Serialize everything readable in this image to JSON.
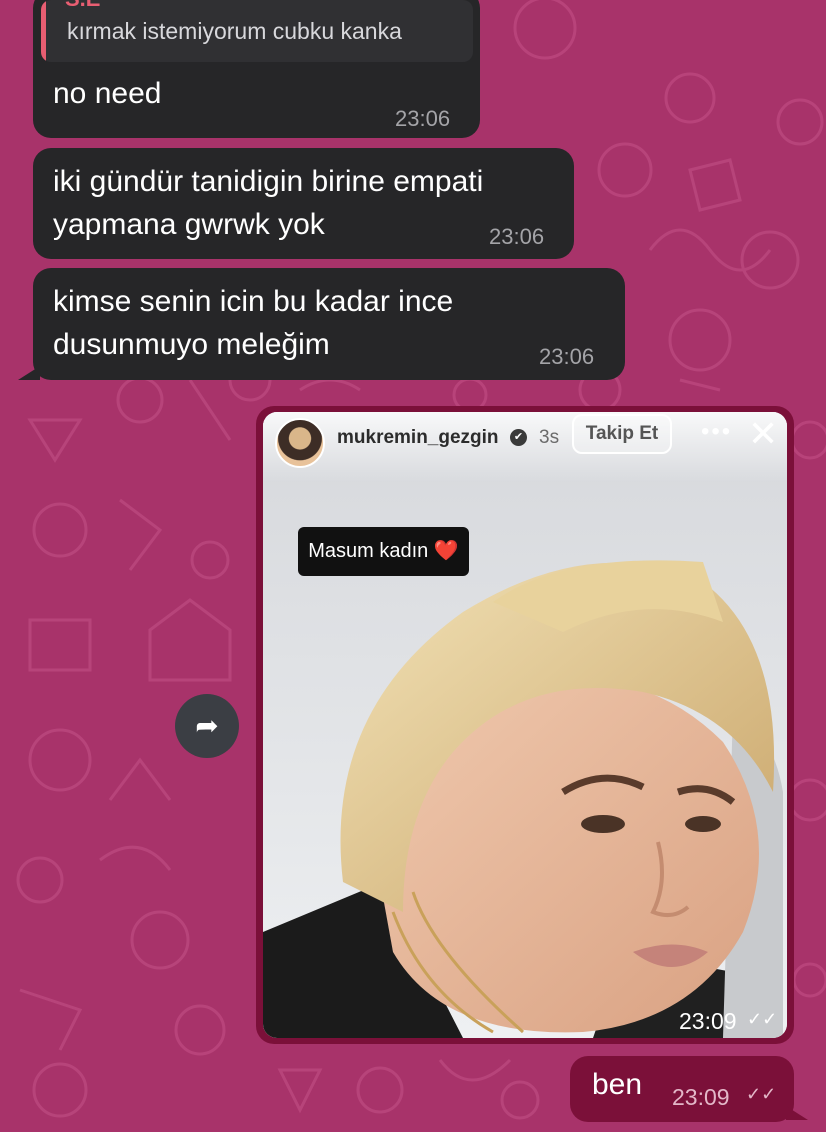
{
  "chat": {
    "reply_preview": {
      "name": "S.E",
      "text": "kırmak istemiyorum cubku kanka"
    },
    "messages": [
      {
        "text": "no need",
        "time": "23:06"
      },
      {
        "text": "iki gündür tanidigin birine empati yapmana gwrwk yok",
        "time": "23:06"
      },
      {
        "text": "kimse senin icin bu kadar ince dusunmuyo meleğim",
        "time": "23:06"
      }
    ],
    "story": {
      "username": "mukremin_gezgin",
      "verified_glyph": "✔",
      "age": "3s",
      "follow_label": "Takip Et",
      "more_glyph": "•••",
      "close_glyph": "✕",
      "sticker_text": "Masum kadın ❤️",
      "time": "23:09",
      "check_glyph": "✓✓"
    },
    "forward_glyph": "➦",
    "outgoing": {
      "text": "ben",
      "time": "23:09",
      "check_glyph": "✓✓"
    }
  },
  "colors": {
    "wallpaper": "#a8336a",
    "incoming_bubble": "#262628",
    "outgoing_bubble": "#7b1039",
    "reply_accent": "#e85e72"
  },
  "icons": [
    "forward-icon",
    "close-icon",
    "more-icon",
    "verified-icon",
    "read-receipt-icon"
  ]
}
